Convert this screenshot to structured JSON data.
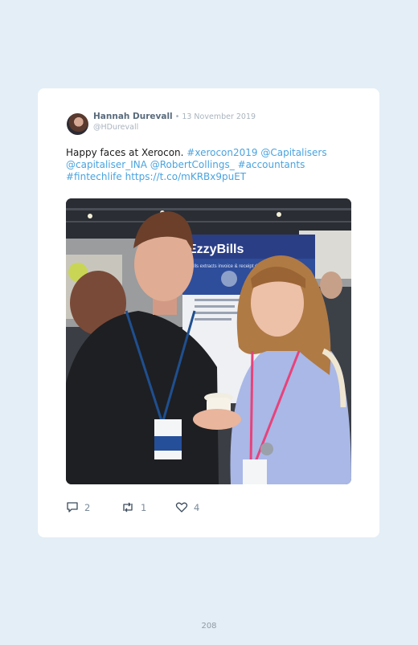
{
  "tweet": {
    "author_name": "Hannah Durevall",
    "date": "13 November 2019",
    "separator": " • ",
    "handle": "@HDurevall",
    "text_plain": "Happy faces at Xerocon. ",
    "link_1": "#xerocon2019",
    "link_2": "@Capitalisers",
    "link_3": "@capitaliser_INA",
    "link_4": "@RobertCollings_",
    "link_5": "#accountants",
    "link_6": "#fintechlife",
    "link_7": "https://t.co/mKRBx9puET",
    "photo_booth_sign": "EzzyBills",
    "photo_booth_tagline": "Bills extracts invoice & receipt data"
  },
  "actions": {
    "replies": "2",
    "retweets": "1",
    "likes": "4"
  },
  "page_number": "208",
  "colors": {
    "background": "#e4eef6",
    "card": "#ffffff",
    "link": "#4aa3df",
    "author": "#596b7c",
    "muted": "#a9b4be"
  },
  "icons": [
    "reply-icon",
    "retweet-icon",
    "like-icon"
  ]
}
